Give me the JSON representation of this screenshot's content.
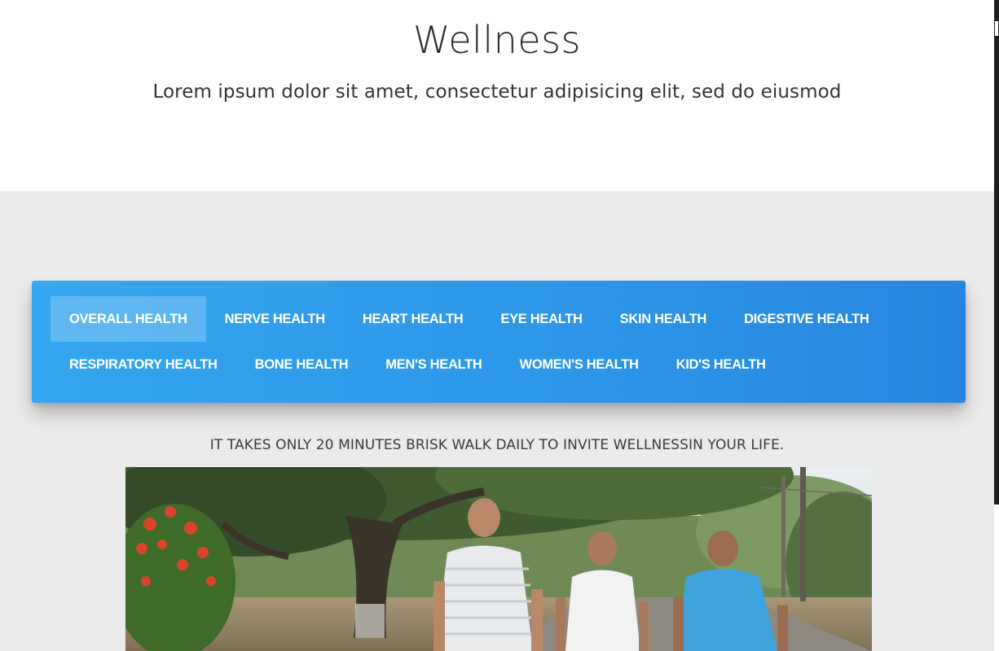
{
  "header": {
    "title": "Wellness",
    "subtitle": "Lorem ipsum dolor sit amet, consectetur adipisicing elit, sed do eiusmod"
  },
  "tabs": {
    "row1": [
      {
        "label": "OVERALL HEALTH",
        "active": true
      },
      {
        "label": "NERVE HEALTH",
        "active": false
      },
      {
        "label": "HEART HEALTH",
        "active": false
      },
      {
        "label": "EYE HEALTH",
        "active": false
      },
      {
        "label": "SKIN HEALTH",
        "active": false
      },
      {
        "label": "DIGESTIVE HEALTH",
        "active": false
      }
    ],
    "row2": [
      {
        "label": "RESPIRATORY HEALTH",
        "active": false
      },
      {
        "label": "BONE HEALTH",
        "active": false
      },
      {
        "label": "MEN'S HEALTH",
        "active": false
      },
      {
        "label": "WOMEN'S HEALTH",
        "active": false
      },
      {
        "label": "KID'S HEALTH",
        "active": false
      }
    ]
  },
  "content": {
    "tagline": "IT TAKES ONLY 20 MINUTES BRISK WALK DAILY TO INVITE WELLNESSIN YOUR LIFE."
  },
  "colors": {
    "tab_bar_start": "#35a6f0",
    "tab_bar_end": "#2686dd",
    "section_background": "#ebebeb"
  }
}
